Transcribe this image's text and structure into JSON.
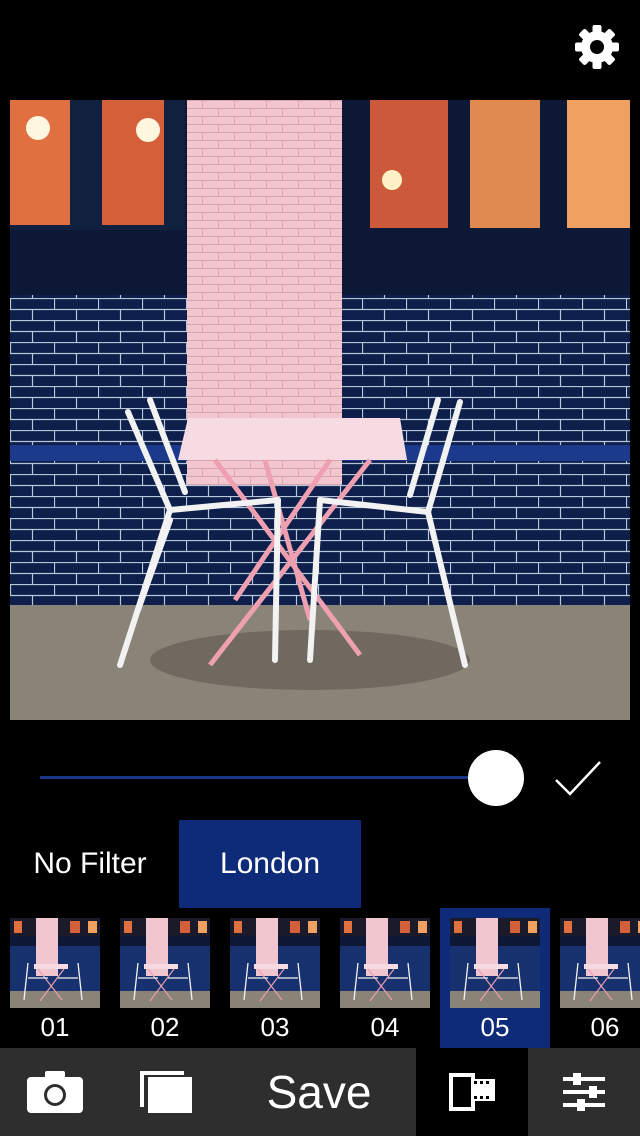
{
  "header": {
    "settings_icon": "gear-icon"
  },
  "editor": {
    "intensity": 0.95,
    "confirm_icon": "checkmark-icon"
  },
  "filters": {
    "tabs": [
      {
        "label": "No Filter",
        "active": false
      },
      {
        "label": "London",
        "active": true
      }
    ],
    "presets": [
      {
        "label": "01",
        "selected": false
      },
      {
        "label": "02",
        "selected": false
      },
      {
        "label": "03",
        "selected": false
      },
      {
        "label": "04",
        "selected": false
      },
      {
        "label": "05",
        "selected": true
      },
      {
        "label": "06",
        "selected": false
      }
    ]
  },
  "toolbar": {
    "camera_icon": "camera-icon",
    "library_icon": "photo-library-icon",
    "save_label": "Save",
    "film_icon": "film-filter-icon",
    "adjust_icon": "sliders-icon"
  },
  "colors": {
    "accent": "#0e2b7a",
    "toolbar_bg": "#2e2e2e",
    "track": "#1a3585"
  }
}
